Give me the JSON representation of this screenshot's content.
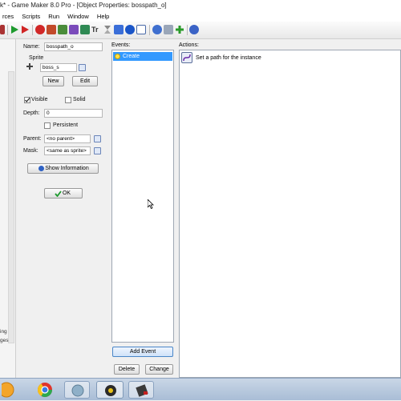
{
  "window": {
    "title": "k* - Game Maker 8.0 Pro - [Object Properties: bosspath_o]"
  },
  "menu": [
    "rces",
    "Scripts",
    "Run",
    "Window",
    "Help"
  ],
  "left_cut_text": [
    "ing",
    "ges"
  ],
  "object": {
    "name_label": "Name:",
    "name_value": "bosspath_o",
    "sprite_label": "Sprite",
    "sprite_value": "boss_s",
    "new_label": "New",
    "edit_label": "Edit",
    "visible_label": "Visible",
    "solid_label": "Solid",
    "depth_label": "Depth:",
    "depth_value": "0",
    "persistent_label": "Persistent",
    "parent_label": "Parent:",
    "parent_value": "<no parent>",
    "mask_label": "Mask:",
    "mask_value": "<same as sprite>",
    "show_info_label": "Show Information",
    "ok_label": "OK"
  },
  "events": {
    "label": "Events:",
    "items": [
      "Create"
    ],
    "add_label": "Add Event",
    "delete_label": "Delete",
    "change_label": "Change"
  },
  "actions": {
    "label": "Actions:",
    "items": [
      "Set a path for the instance"
    ]
  },
  "colors": {
    "selection": "#3399ff",
    "taskbar": "#b4c6dc"
  },
  "taskbar_icons": [
    "start-orb-icon",
    "chrome-icon",
    "app-icon",
    "game-maker-icon",
    "tool-icon"
  ]
}
